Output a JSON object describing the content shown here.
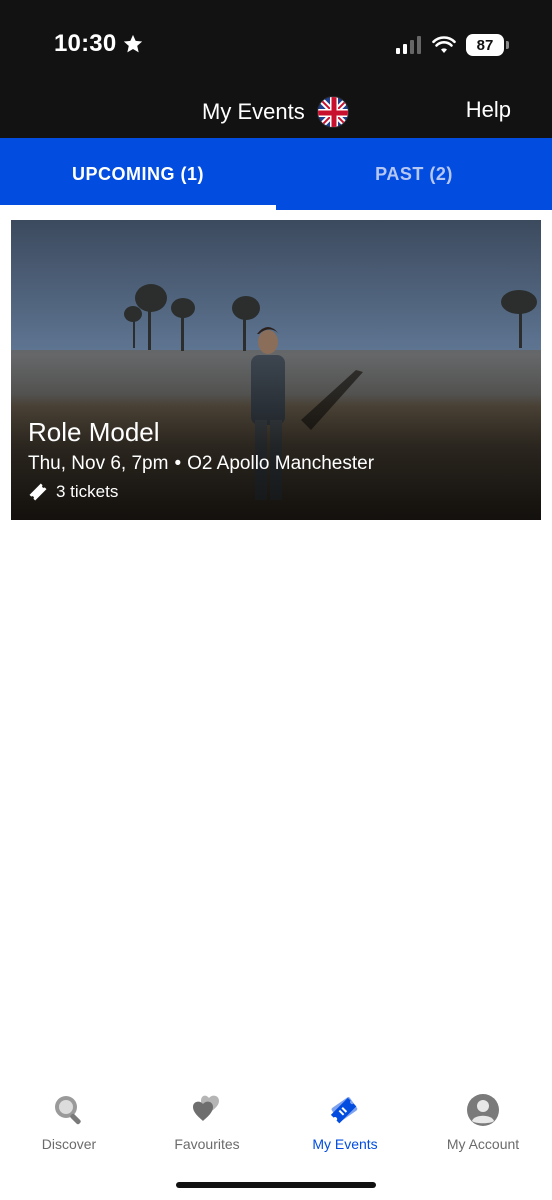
{
  "status_bar": {
    "time": "10:30",
    "battery": "87"
  },
  "header": {
    "title": "My Events",
    "help": "Help"
  },
  "tabs": [
    {
      "label": "UPCOMING (1)",
      "active": true
    },
    {
      "label": "PAST (2)",
      "active": false
    }
  ],
  "event": {
    "title": "Role Model",
    "date": "Thu, Nov 6, 7pm",
    "separator": "•",
    "venue": "O2 Apollo Manchester",
    "tickets": "3 tickets"
  },
  "bottom_nav": {
    "items": [
      {
        "label": "Discover",
        "icon": "search-icon",
        "active": false
      },
      {
        "label": "Favourites",
        "icon": "hearts-icon",
        "active": false
      },
      {
        "label": "My Events",
        "icon": "ticket-icon",
        "active": true
      },
      {
        "label": "My Account",
        "icon": "user-icon",
        "active": false
      }
    ]
  },
  "colors": {
    "accent": "#024ddf",
    "header_bg": "#121212",
    "inactive_tab": "#b7c7f4",
    "nav_inactive": "#6b6b6b"
  }
}
